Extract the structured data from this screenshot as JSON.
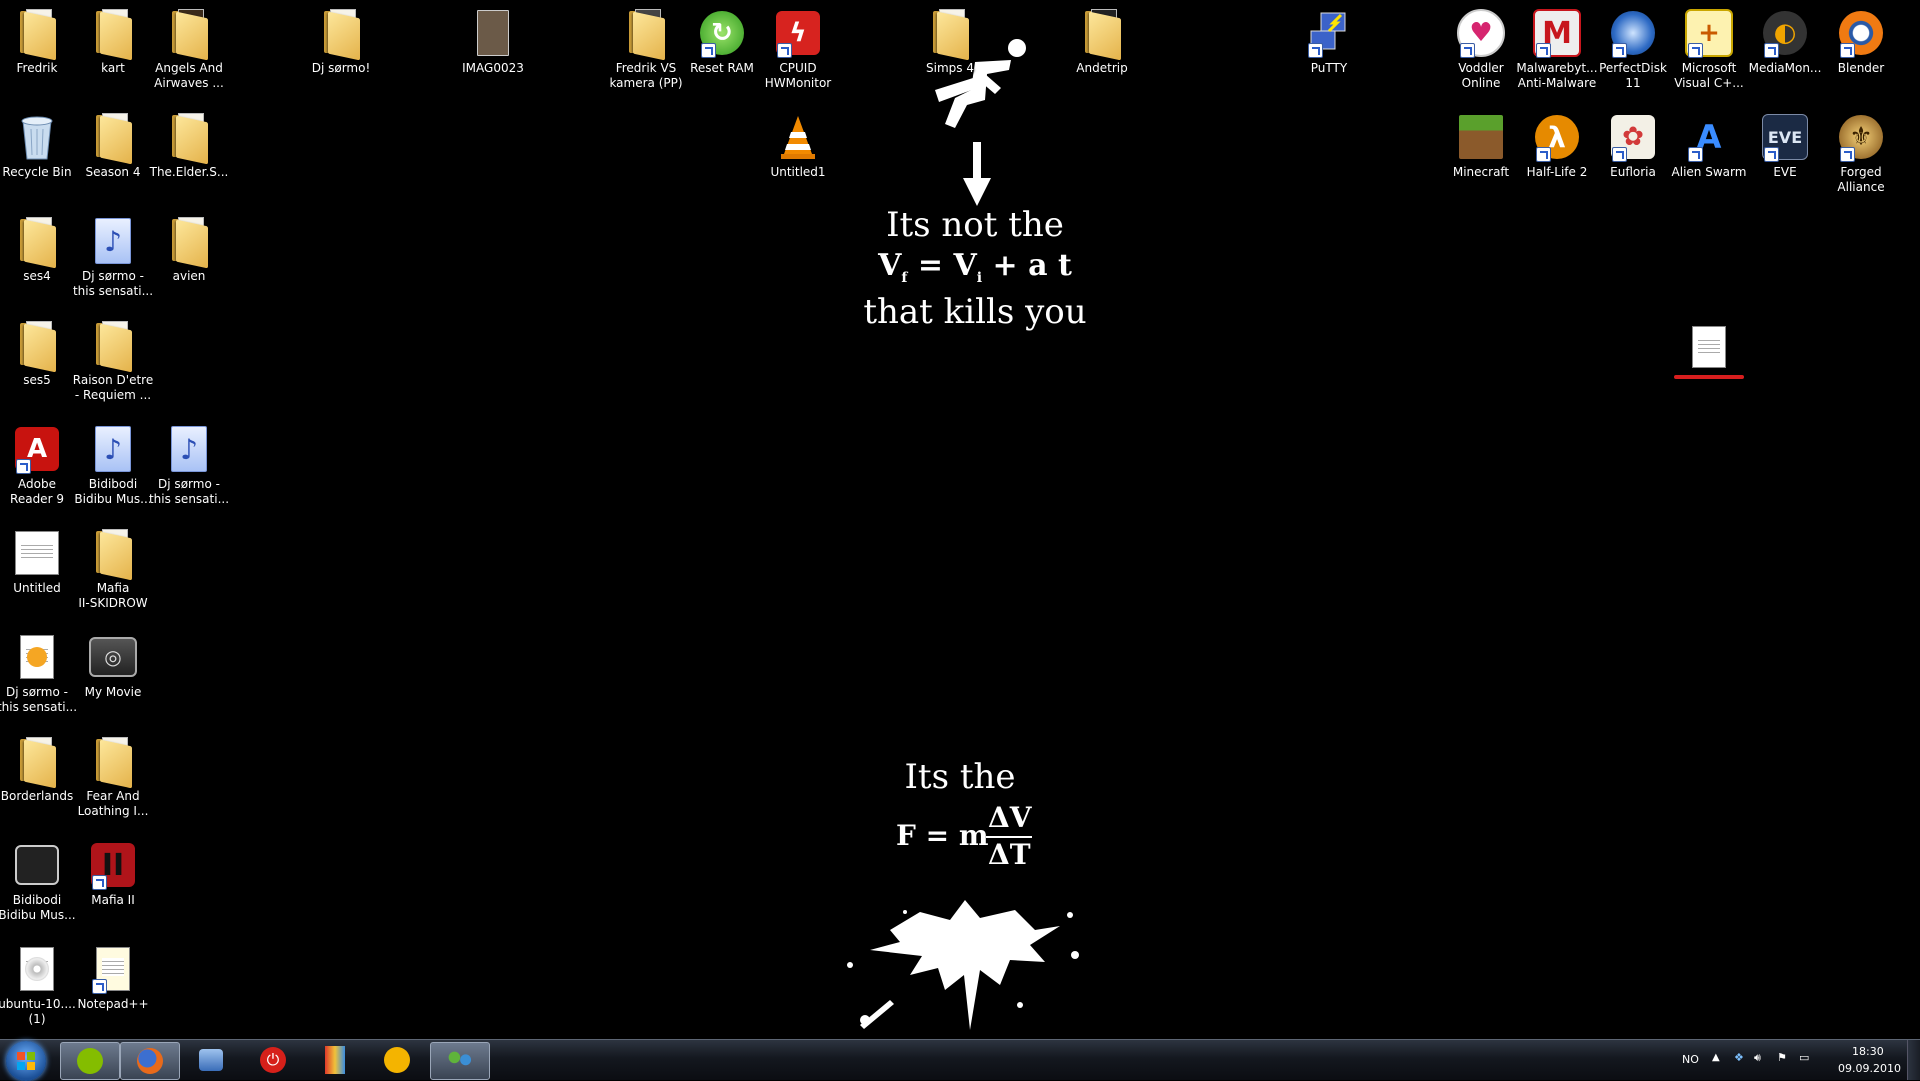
{
  "desktop": {
    "icons": {
      "fredrik": "Fredrik",
      "kart": "kart",
      "angels": "Angels And\nAirwaves ...",
      "dj_sormo": "Dj sørmo!",
      "imag": "IMAG0023",
      "fredrik_vs": "Fredrik VS\nkamera (PP)",
      "reset_ram": "Reset RAM",
      "cpuid": "CPUID\nHWMonitor",
      "simps4": "Simps 4",
      "andetrip": "Andetrip",
      "putty": "PuTTY",
      "voddler": "Voddler\nOnline",
      "malwarebytes": "Malwarebyt...\nAnti-Malware",
      "perfectdisk": "PerfectDisk\n11",
      "ms_visual": "Microsoft\nVisual C+...",
      "mediamon": "MediaMon...",
      "blender": "Blender",
      "recycle_bin": "Recycle Bin",
      "season4": "Season 4",
      "elder_s": "The.Elder.S...",
      "untitled1": "Untitled1",
      "minecraft": "Minecraft",
      "halflife2": "Half-Life 2",
      "eufloria": "Eufloria",
      "alien_swarm": "Alien Swarm",
      "eve": "EVE",
      "forged_alliance": "Forged\nAlliance",
      "ses4": "ses4",
      "dj_sormo_sens1": "Dj sørmo -\nthis sensati...",
      "avien": "avien",
      "ses5": "ses5",
      "raison": "Raison D'etre\n- Requiem ...",
      "adobe_reader": "Adobe\nReader 9",
      "bidibodi1": "Bidibodi\nBidibu Mus...",
      "dj_sormo_sens2": "Dj sørmo -\nthis sensati...",
      "untitled": "Untitled",
      "mafia_skidrow": "Mafia\nII-SKIDROW",
      "dj_sormo_sens3": "Dj sørmo -\nthis sensati...",
      "my_movie": "My Movie",
      "borderlands": "Borderlands",
      "fear_loathing": "Fear And\nLoathing I...",
      "bidibodi2": "Bidibodi\nBidibu Mus...",
      "mafia2": "Mafia II",
      "ubuntu": "ubuntu-10....\n(1)",
      "notepadpp": "Notepad++",
      "renamed_file": ""
    },
    "wallpaper": {
      "line1": "Its not the",
      "eq_v": "V",
      "eq_f": "f",
      "eq_mid": " = V",
      "eq_i": "i",
      "eq_end": " + a t",
      "line3": "that kills you",
      "line4": "Its the",
      "eq2_lhs": "F = m",
      "eq2_num": "ΔV",
      "eq2_den": "ΔT"
    }
  },
  "taskbar": {
    "language": "NO",
    "time": "18:30",
    "date": "09.09.2010"
  },
  "colors": {
    "background": "#000000",
    "rename_underline": "#d81e1e"
  }
}
